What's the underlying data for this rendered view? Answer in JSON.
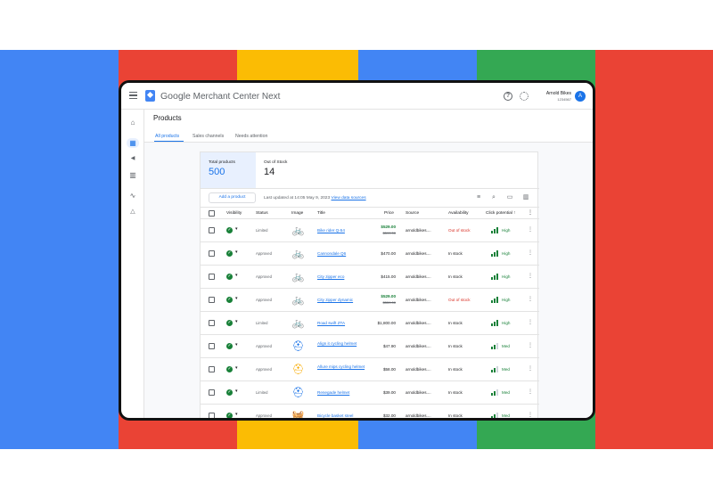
{
  "background_colors": [
    "#4285f4",
    "#ea4335",
    "#fbbc04",
    "#4285f4",
    "#34a853",
    "#ea4335"
  ],
  "header": {
    "brand_google": "Google",
    "brand_product": "Merchant Center Next",
    "account_name": "Arnold Bikes",
    "account_id": "1234567",
    "avatar_letter": "A",
    "help_icon": "help-icon",
    "settings_icon": "gear-icon"
  },
  "rail": {
    "items": [
      {
        "icon": "home-icon",
        "glyph": "⌂"
      },
      {
        "icon": "products-grid-icon",
        "glyph": "▦"
      },
      {
        "icon": "megaphone-icon",
        "glyph": "📢"
      },
      {
        "icon": "store-icon",
        "glyph": "▥"
      },
      {
        "icon": "trending-icon",
        "glyph": "∿"
      },
      {
        "icon": "bell-icon",
        "glyph": "🔔"
      }
    ]
  },
  "page": {
    "title": "Products",
    "tabs": [
      {
        "label": "All products",
        "active": true
      },
      {
        "label": "Sales channels",
        "active": false
      },
      {
        "label": "Needs attention",
        "active": false
      }
    ]
  },
  "stats": {
    "total_label": "Total products",
    "total_value": "500",
    "out_label": "Out of Stock",
    "out_value": "14"
  },
  "toolbar": {
    "add_label": "Add a product",
    "updated_text": "Last updated at 14:05 May 9, 2023",
    "sources_link": "View data sources"
  },
  "table": {
    "headers": {
      "visibility": "Visibility",
      "status": "Status",
      "image": "Image",
      "title": "Title",
      "price": "Price",
      "source": "Source",
      "availability": "Availability",
      "click_potential": "Click potential"
    },
    "rows": [
      {
        "status": "Limited",
        "image": "bike",
        "title": "Bike rider Q-54",
        "price": "$529.00",
        "old_price": "$599.00",
        "source": "arnoldbikes....",
        "availability": "Out of stock",
        "potential": "High"
      },
      {
        "status": "Approved",
        "image": "bike",
        "title": "Cannondale Q6",
        "price": "$470.00",
        "old_price": "",
        "source": "arnoldbikes....",
        "availability": "In stock",
        "potential": "High"
      },
      {
        "status": "Approved",
        "image": "bike-red",
        "title": "City zipper eco",
        "price": "$415.00",
        "old_price": "",
        "source": "arnoldbikes....",
        "availability": "In stock",
        "potential": "High"
      },
      {
        "status": "Approved",
        "image": "bike-red",
        "title": "City zipper dynamic",
        "price": "$529.00",
        "old_price": "$559.00",
        "source": "arnoldbikes....",
        "availability": "Out of stock",
        "potential": "High"
      },
      {
        "status": "Limited",
        "image": "bike",
        "title": "Road swift ZTA",
        "price": "$1,800.00",
        "old_price": "",
        "source": "arnoldbikes....",
        "availability": "In stock",
        "potential": "High"
      },
      {
        "status": "Approved",
        "image": "helmet-blue",
        "title": "Align it cycling helmet",
        "price": "$47.90",
        "old_price": "",
        "source": "arnoldbikes....",
        "availability": "In stock",
        "potential": "Med"
      },
      {
        "status": "Approved",
        "image": "helmet-yellow",
        "title": "Allure mips cycling helmet",
        "price": "$58.00",
        "old_price": "",
        "source": "arnoldbikes....",
        "availability": "In stock",
        "potential": "Med"
      },
      {
        "status": "Limited",
        "image": "helmet-blue",
        "title": "Renegade helmet",
        "price": "$39.00",
        "old_price": "",
        "source": "arnoldbikes....",
        "availability": "In stock",
        "potential": "Med"
      },
      {
        "status": "Approved",
        "image": "basket",
        "title": "Bicycle basket steel",
        "price": "$32.00",
        "old_price": "",
        "source": "arnoldbikes....",
        "availability": "In stock",
        "potential": "Med"
      }
    ]
  }
}
